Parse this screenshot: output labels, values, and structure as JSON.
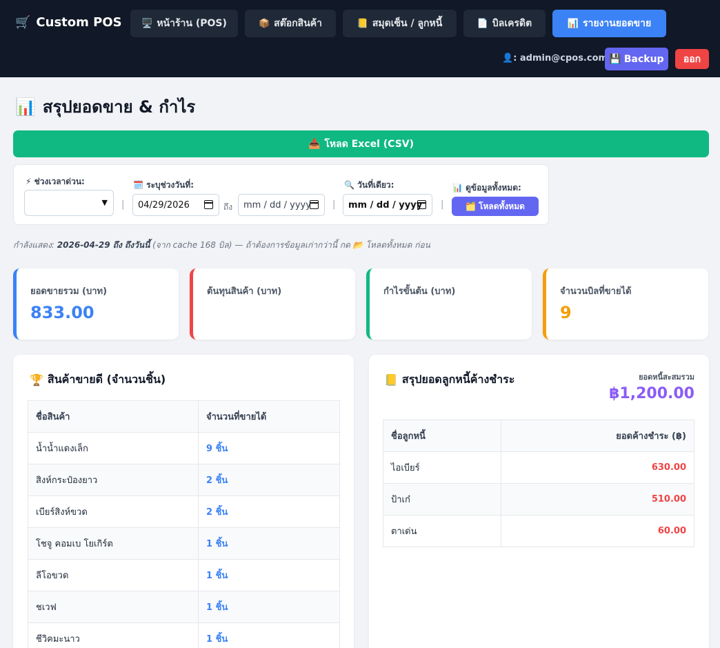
{
  "nav": {
    "brand": "Custom POS",
    "brand_icon": "🛒",
    "items": [
      {
        "icon": "🖥️",
        "label": "หน้าร้าน (POS)",
        "active": false
      },
      {
        "icon": "📦",
        "label": "สต๊อกสินค้า",
        "active": false
      },
      {
        "icon": "📒",
        "label": "สมุดเซ็น / ลูกหนี้",
        "active": false
      },
      {
        "icon": "📄",
        "label": "บิลเครดิต",
        "active": false
      },
      {
        "icon": "📊",
        "label": "รายงานยอดขาย",
        "active": true
      }
    ],
    "user_icon": "👤",
    "user": ": admin@cpos.com",
    "backup_icon": "💾",
    "backup_label": "Backup",
    "logout_label": "ออก"
  },
  "page": {
    "title_icon": "📊",
    "title": "สรุปยอดขาย & กำไร",
    "export_icon": "📥",
    "export_label": "โหลด Excel (CSV)"
  },
  "filters": {
    "quick_icon": "⚡",
    "quick_label": "ช่วงเวลาด่วน:",
    "quick_value": "",
    "range_icon": "🗓️",
    "range_label": "ระบุช่วงวันที่:",
    "range_from": "04/29/2026",
    "range_to_word": "ถึง",
    "range_to_placeholder": "mm / dd / yyyy",
    "single_icon": "🔍",
    "single_label": "วันที่เดียว:",
    "single_placeholder": "mm / dd / yyyy",
    "all_icon": "📊",
    "all_label": "ดูข้อมูลทั้งหมด:",
    "load_all_icon": "🗂️",
    "load_all_label": "โหลดทั้งหมด"
  },
  "info": {
    "prefix": "กำลังแสดง: ",
    "range": "2026-04-29 ถึง ถึงวันนี้",
    "suffix": " (จาก cache 168 บิล) — ถ้าต้องการข้อมูลเก่ากว่านี้ กด 📂 โหลดทั้งหมด ก่อน"
  },
  "stats": [
    {
      "label": "ยอดขายรวม (บาท)",
      "value": "833.00",
      "color": "#3b82f6"
    },
    {
      "label": "ต้นทุนสินค้า (บาท)",
      "value": "",
      "color": "#ef4444"
    },
    {
      "label": "กำไรขั้นต้น (บาท)",
      "value": "",
      "color": "#10b981"
    },
    {
      "label": "จำนวนบิลที่ขายได้",
      "value": "9",
      "color": "#f59e0b"
    }
  ],
  "bestsellers": {
    "icon": "🏆",
    "title": "สินค้าขายดี (จำนวนชิ้น)",
    "headers": [
      "ชื่อสินค้า",
      "จำนวนที่ขายได้"
    ],
    "rows": [
      [
        "น้ำน้ำแดงเล็ก",
        "9 ชิ้น"
      ],
      [
        "สิงห์กระป๋องยาว",
        "2 ชิ้น"
      ],
      [
        "เบียร์สิงห์ขวด",
        "2 ชิ้น"
      ],
      [
        "โชจู คอมเบ โยเกิร์ต",
        "1 ชิ้น"
      ],
      [
        "ลีโอขวด",
        "1 ชิ้น"
      ],
      [
        "ชเวฟ",
        "1 ชิ้น"
      ],
      [
        "ชีวิคมะนาว",
        "1 ชิ้น"
      ]
    ]
  },
  "debts": {
    "icon": "📒",
    "title": "สรุปยอดลูกหนี้ค้างชำระ",
    "total_label": "ยอดหนี้สะสมรวม",
    "total_value": "฿1,200.00",
    "headers": [
      "ชื่อลูกหนี้",
      "ยอดค้างชำระ (฿)"
    ],
    "rows": [
      [
        "ไอเบียร์",
        "630.00"
      ],
      [
        "ป้าเก๋",
        "510.00"
      ],
      [
        "ตาเด่น",
        "60.00"
      ]
    ]
  }
}
